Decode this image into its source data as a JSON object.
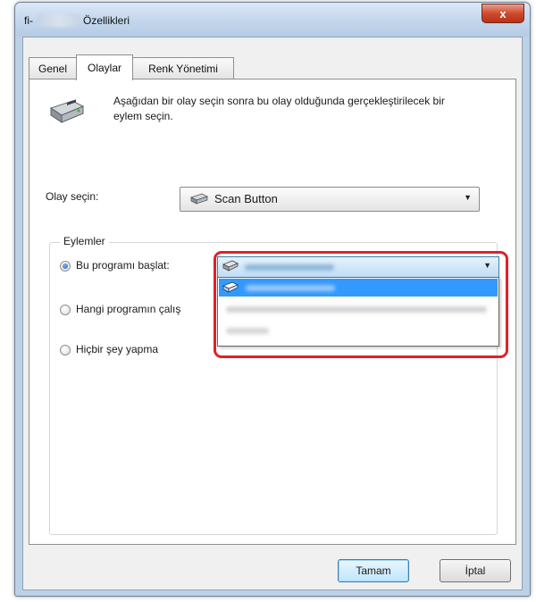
{
  "window": {
    "title_prefix": "fi-",
    "title_suffix": "Özellikleri",
    "close_glyph": "x"
  },
  "tabs": [
    {
      "label": "Genel",
      "active": false
    },
    {
      "label": "Olaylar",
      "active": true
    },
    {
      "label": "Renk Yönetimi",
      "active": false
    }
  ],
  "events_panel": {
    "description": "Aşağıdan bir olay seçin sonra bu olay olduğunda gerçekleştirilecek bir eylem seçin.",
    "scanner_icon": "scanner-icon",
    "event_label": "Olay seçin:",
    "event_value": "Scan Button",
    "event_value_icon": "scanner-small-icon"
  },
  "actions": {
    "group_label": "Eylemler",
    "options": [
      {
        "label": "Bu programı başlat:",
        "checked": true
      },
      {
        "label": "Hangi programın çalış",
        "checked": false
      },
      {
        "label": "Hiçbir şey yapma",
        "checked": false
      }
    ],
    "program_dropdown": {
      "selected_icon": "program-icon",
      "open": true,
      "items_icon": "program-icon"
    },
    "highlight_color": "#e0202a"
  },
  "buttons": {
    "ok": "Tamam",
    "cancel": "İptal"
  }
}
